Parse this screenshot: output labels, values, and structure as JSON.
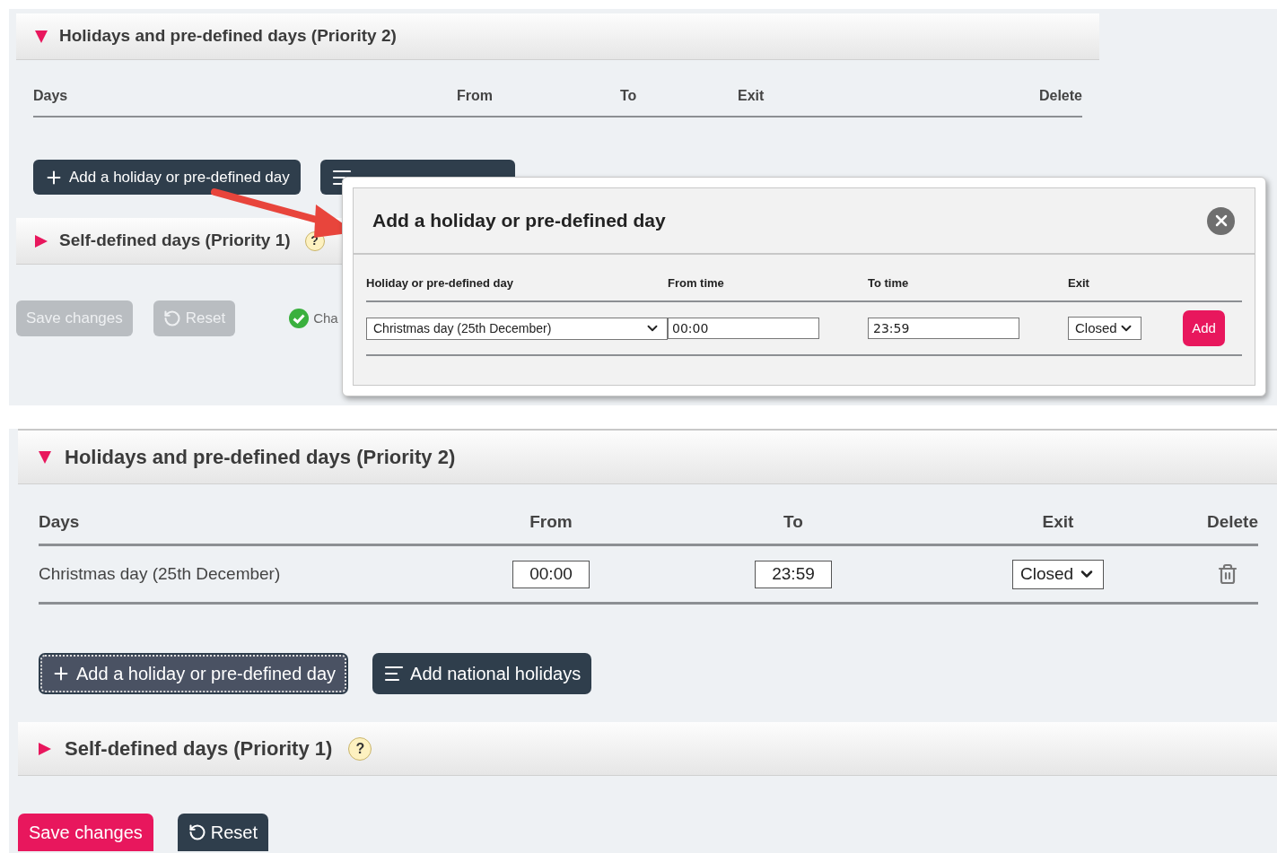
{
  "screens": [
    {
      "section": {
        "title": "Holidays and pre-defined days (Priority 2)",
        "expanded": true
      },
      "columns": [
        "Days",
        "From",
        "To",
        "Exit",
        "Delete"
      ],
      "actions": [
        {
          "kind": "add",
          "label": "Add a holiday or pre-defined day",
          "focused": false
        },
        {
          "kind": "national",
          "focused": false
        }
      ],
      "collapsed_section": {
        "title": "Self-defined days (Priority 1)",
        "expanded": false,
        "help": "?"
      },
      "footer": {
        "buttons": [
          {
            "label": "Save changes",
            "kind": "primary",
            "disabled": true
          },
          {
            "label": "Reset",
            "kind": "reset",
            "disabled": true
          }
        ],
        "status": "Cha"
      },
      "dialog": {
        "title": "Add a holiday or pre-defined day",
        "columns": [
          "Holiday or pre-defined day",
          "From time",
          "To time",
          "Exit"
        ],
        "day": "Christmas day (25th December)",
        "from": "00:00",
        "to": "23:59",
        "exit": "Closed",
        "add": "Add"
      }
    },
    {
      "section": {
        "title": "Holidays and pre-defined days (Priority 2)",
        "expanded": true
      },
      "columns": [
        "Days",
        "From",
        "To",
        "Exit",
        "Delete"
      ],
      "rows": [
        {
          "day": "Christmas day (25th December)",
          "from": "00:00",
          "to": "23:59",
          "exit": "Closed"
        }
      ],
      "actions": [
        {
          "kind": "add",
          "label": "Add a holiday or pre-defined day",
          "focused": true
        },
        {
          "kind": "national",
          "label": "Add national holidays",
          "focused": false
        }
      ],
      "collapsed_section": {
        "title": "Self-defined days (Priority 1)",
        "expanded": false,
        "help": "?"
      },
      "footer": {
        "buttons": [
          {
            "label": "Save changes",
            "kind": "primary",
            "disabled": false
          },
          {
            "label": "Reset",
            "kind": "reset",
            "disabled": false
          }
        ]
      }
    }
  ]
}
